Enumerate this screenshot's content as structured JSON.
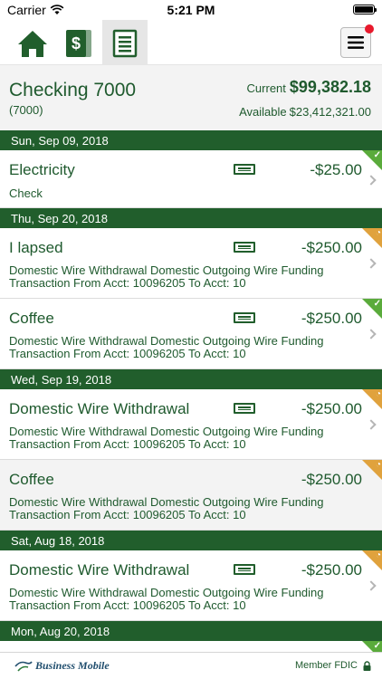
{
  "status_bar": {
    "carrier": "Carrier",
    "time": "5:21 PM"
  },
  "nav": {
    "home_icon": "home-icon",
    "bills_icon": "dollar-bill-icon",
    "register_icon": "register-icon",
    "menu_icon": "hamburger-menu-icon",
    "active_tab": "register"
  },
  "account": {
    "name": "Checking 7000",
    "number": "(7000)",
    "current_label": "Current",
    "current_value": "$99,382.18",
    "available_label": "Available",
    "available_value": "$23,412,321.00"
  },
  "groups": [
    {
      "date": "Sun, Sep 09, 2018",
      "transactions": [
        {
          "title": "Electricity",
          "amount": "-$25.00",
          "check_label": "Check",
          "status": "cleared",
          "has_check_icon": true
        }
      ]
    },
    {
      "date": "Thu, Sep 20, 2018",
      "transactions": [
        {
          "title": "I lapsed",
          "amount": "-$250.00",
          "desc1": "Domestic Wire Withdrawal  Domestic Outgoing Wire Funding",
          "desc2": "Transaction From Acct: 10096205 To Acct: 10",
          "status": "pending",
          "has_check_icon": true
        },
        {
          "title": "Coffee",
          "amount": "-$250.00",
          "desc1": "Domestic Wire Withdrawal  Domestic Outgoing Wire Funding",
          "desc2": "Transaction From Acct: 10096205 To Acct: 10",
          "status": "cleared",
          "has_check_icon": true
        }
      ]
    },
    {
      "date": "Wed, Sep 19, 2018",
      "transactions": [
        {
          "title": "Domestic Wire Withdrawal",
          "amount": "-$250.00",
          "desc1": "Domestic Wire Withdrawal  Domestic Outgoing Wire Funding",
          "desc2": "Transaction From Acct: 10096205 To Acct: 10",
          "status": "pending",
          "has_check_icon": true
        },
        {
          "title": "Coffee",
          "amount": "-$250.00",
          "desc1": "Domestic Wire Withdrawal  Domestic Outgoing Wire Funding",
          "desc2": "Transaction From Acct: 10096205 To Acct: 10",
          "status": "pending",
          "has_check_icon": false
        }
      ]
    },
    {
      "date": "Sat, Aug 18, 2018",
      "transactions": [
        {
          "title": "Domestic Wire Withdrawal",
          "amount": "-$250.00",
          "desc1": "Domestic Wire Withdrawal  Domestic Outgoing Wire Funding",
          "desc2": "Transaction From Acct: 10096205 To Acct: 10",
          "status": "pending",
          "has_check_icon": true
        }
      ]
    },
    {
      "date": "Mon, Aug 20, 2018",
      "transactions": []
    }
  ],
  "footer": {
    "logo_text": "Business Mobile",
    "fdic": "Member FDIC"
  },
  "colors": {
    "brand_green": "#215e2c",
    "text_green": "#1f5a2e",
    "cleared_corner": "#5aab3b",
    "pending_corner": "#e0a23d",
    "notify_dot": "#e8192c"
  }
}
